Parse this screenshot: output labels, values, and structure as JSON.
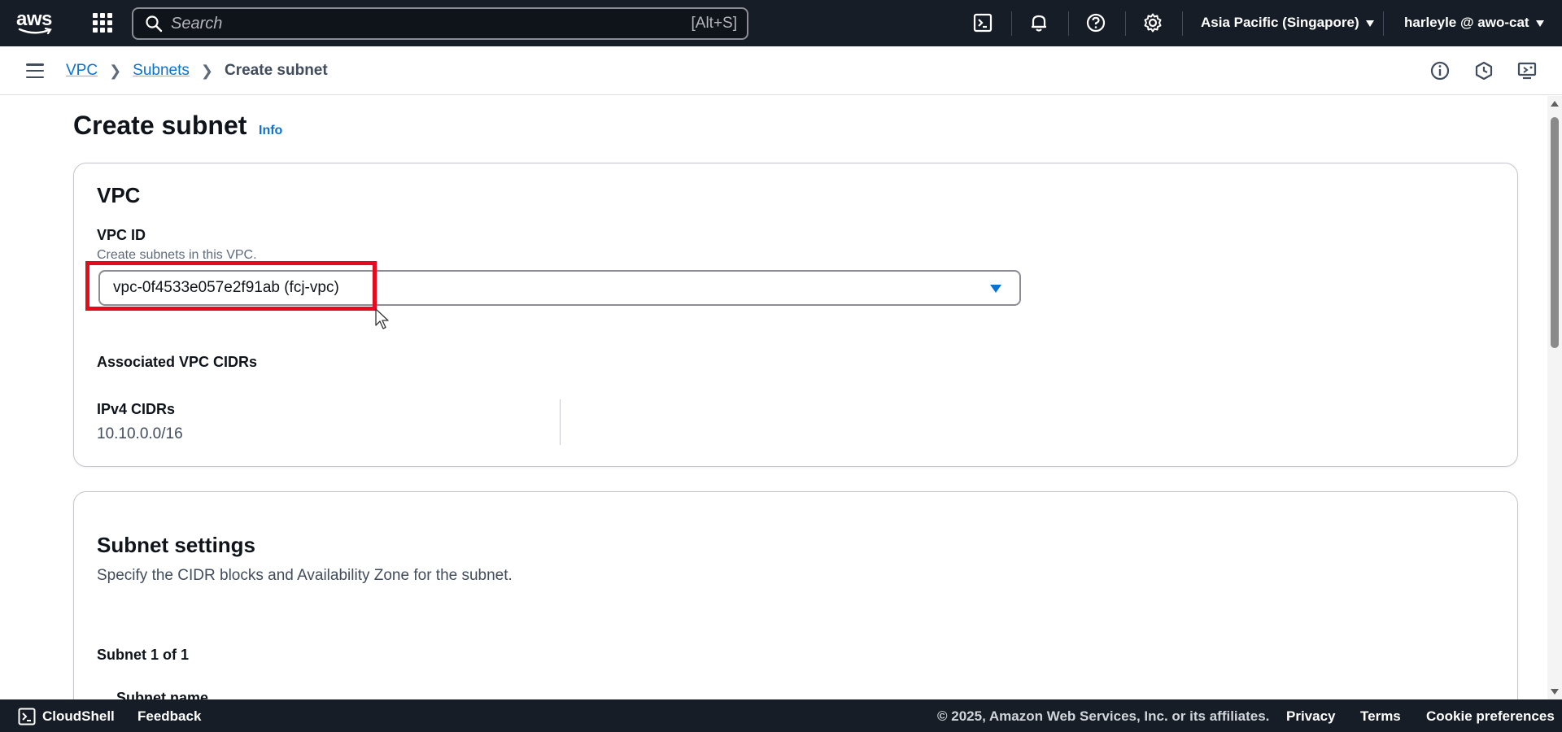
{
  "topnav": {
    "logo_text": "aws",
    "search_placeholder": "Search",
    "search_shortcut": "[Alt+S]",
    "icons": [
      "cloudshell-icon",
      "bell-icon",
      "help-icon",
      "gear-icon"
    ],
    "region": "Asia Pacific (Singapore)",
    "user": "harleyle @ awo-cat"
  },
  "breadcrumb": {
    "items": [
      "VPC",
      "Subnets"
    ],
    "current": "Create subnet"
  },
  "page": {
    "title": "Create subnet",
    "info": "Info"
  },
  "vpc_card": {
    "heading": "VPC",
    "vpc_id_label": "VPC ID",
    "vpc_id_desc": "Create subnets in this VPC.",
    "vpc_selected": "vpc-0f4533e057e2f91ab (fcj-vpc)",
    "assoc_label": "Associated VPC CIDRs",
    "ipv4_label": "IPv4 CIDRs",
    "ipv4_value": "10.10.0.0/16"
  },
  "subnet_card": {
    "heading": "Subnet settings",
    "desc": "Specify the CIDR blocks and Availability Zone for the subnet.",
    "count_label": "Subnet 1 of 1",
    "name_label": "Subnet name"
  },
  "footer": {
    "cloudshell": "CloudShell",
    "feedback": "Feedback",
    "copyright": "© 2025, Amazon Web Services, Inc. or its affiliates.",
    "privacy": "Privacy",
    "terms": "Terms",
    "cookies": "Cookie preferences"
  },
  "colors": {
    "nav_bg": "#161d26",
    "link": "#0972d3",
    "highlight": "#e8091a"
  }
}
